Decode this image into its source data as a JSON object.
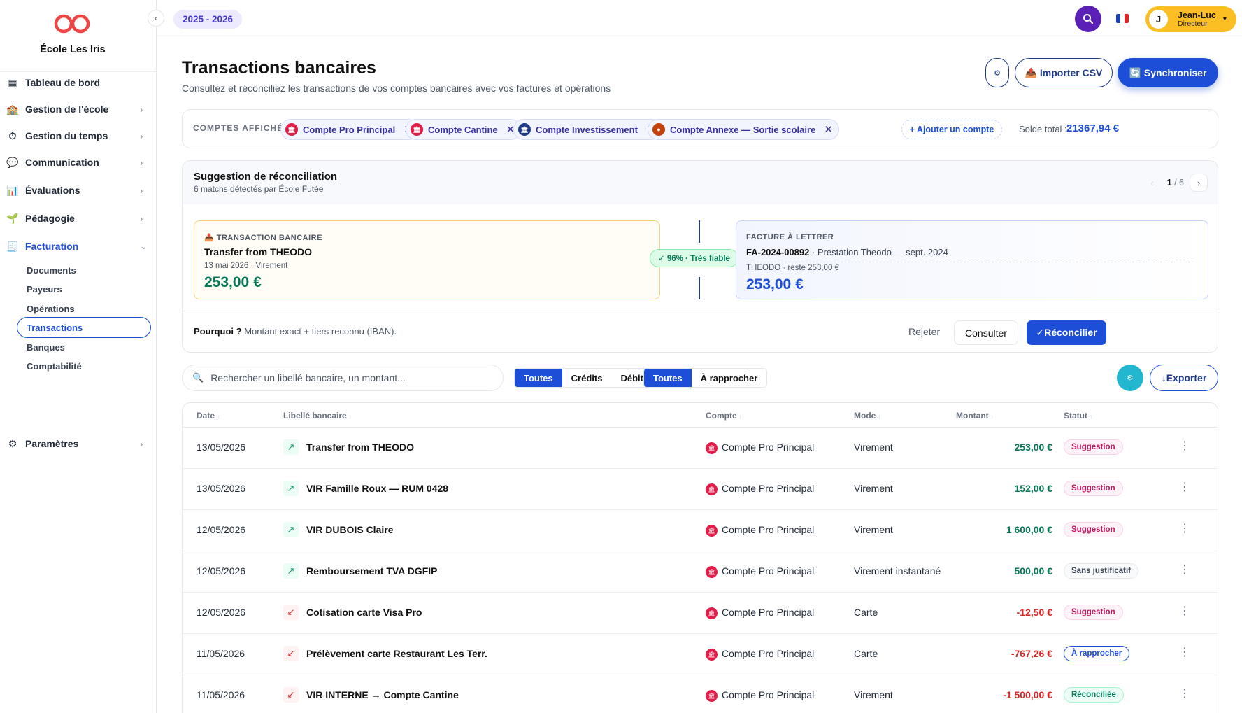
{
  "sidebar": {
    "school_name": "École Les Iris",
    "collapse_icon": "‹",
    "nav": [
      {
        "label": "Tableau de bord",
        "icon": "▦",
        "icon_name": "dashboard-icon",
        "chevron": ""
      },
      {
        "label": "Gestion de l'école",
        "icon": "🏫",
        "icon_name": "school-icon",
        "chevron": "›"
      },
      {
        "label": "Gestion du temps",
        "icon": "⏱",
        "icon_name": "clock-icon",
        "chevron": "›"
      },
      {
        "label": "Communication",
        "icon": "💬",
        "icon_name": "chat-icon",
        "chevron": "›"
      },
      {
        "label": "Évaluations",
        "icon": "📊",
        "icon_name": "chart-icon",
        "chevron": "›"
      },
      {
        "label": "Pédagogie",
        "icon": "🌱",
        "icon_name": "sprout-icon",
        "chevron": "›"
      },
      {
        "label": "Facturation",
        "icon": "🧾",
        "icon_name": "invoice-icon",
        "chevron": "⌄"
      }
    ],
    "sub": [
      "Documents",
      "Payeurs",
      "Opérations",
      "Transactions",
      "Banques",
      "Comptabilité"
    ],
    "settings": {
      "label": "Paramètres",
      "icon": "⚙",
      "chevron": "›"
    }
  },
  "topbar": {
    "year": "2025 - 2026",
    "user_initial": "J",
    "user_name": "Jean-Luc",
    "user_role": "Directeur",
    "chevron": "▾",
    "flag_colors": [
      "#1e40af",
      "#ffffff",
      "#dc2626"
    ]
  },
  "page": {
    "title": "Transactions bancaires",
    "subtitle": "Consultez et réconciliez les transactions de vos comptes bancaires avec vos factures et opérations",
    "gear_icon": "⚙",
    "import_label": "📤 Importer CSV",
    "sync_label": "🔄 Synchroniser"
  },
  "accounts": {
    "title": "COMPTES AFFICHÉS",
    "chips": [
      {
        "label": "Compte Pro Principal",
        "color": "#e11d48",
        "icon": "🏛"
      },
      {
        "label": "Compte Cantine",
        "color": "#e11d48",
        "icon": "🏛"
      },
      {
        "label": "Compte Investissement",
        "color": "#1e3a8a",
        "icon": "🏛"
      },
      {
        "label": "Compte Annexe — Sortie scolaire",
        "color": "#c2410c",
        "icon": "●"
      }
    ],
    "remove_icon": "✕",
    "add_label": "+ Ajouter un compte",
    "total_label": "Solde total :",
    "total_value": "21367,94 €"
  },
  "suggestion": {
    "title": "Suggestion de réconciliation",
    "subtitle": "6 matchs détectés par École Futée",
    "prev": "‹",
    "next": "›",
    "page_current": "1",
    "page_total": "/ 6",
    "transaction": {
      "label": "📤 TRANSACTION BANCAIRE",
      "title": "Transfer from THEODO",
      "meta": "13 mai 2026 · Virement",
      "amount": "253,00 €"
    },
    "match": "✓ 96% · Très fiable",
    "invoice": {
      "label": "FACTURE À LETTRER",
      "ref": "FA-2024-00892",
      "desc": " · Prestation Theodo — sept. 2024",
      "meta": "THEODO · reste 253,00 €",
      "amount": "253,00 €"
    },
    "why_label": "Pourquoi ?",
    "why_text": " Montant exact + tiers reconnu (IBAN).",
    "reject": "Rejeter",
    "consult": "Consulter",
    "reconcile": "✓Réconcilier"
  },
  "filters": {
    "search_placeholder": "Rechercher un libellé bancaire, un montant...",
    "search_icon": "🔍",
    "type_segments": [
      "Toutes",
      "Crédits",
      "Débits"
    ],
    "status_segments": [
      "Toutes",
      "À rapprocher"
    ],
    "filter_icon": "⚙",
    "export_label": "↓Exporter"
  },
  "table": {
    "headers": [
      "Date",
      "Libellé bancaire",
      "Compte",
      "Mode",
      "Montant",
      "Statut"
    ],
    "sort_icon": "↕",
    "rows": [
      {
        "date": "13/05/2026",
        "dir": "↗",
        "libelle": "Transfer from THEODO",
        "compte": "Compte Pro Principal",
        "mode": "Virement",
        "montant": "253,00 €",
        "statut": "Suggestion"
      },
      {
        "date": "13/05/2026",
        "dir": "↗",
        "libelle": "VIR Famille Roux — RUM 0428",
        "compte": "Compte Pro Principal",
        "mode": "Virement",
        "montant": "152,00 €",
        "statut": "Suggestion"
      },
      {
        "date": "12/05/2026",
        "dir": "↗",
        "libelle": "VIR DUBOIS Claire",
        "compte": "Compte Pro Principal",
        "mode": "Virement",
        "montant": "1 600,00 €",
        "statut": "Suggestion"
      },
      {
        "date": "12/05/2026",
        "dir": "↗",
        "libelle": "Remboursement TVA DGFIP",
        "compte": "Compte Pro Principal",
        "mode": "Virement instantané",
        "montant": "500,00 €",
        "statut": "Sans justificatif"
      },
      {
        "date": "12/05/2026",
        "dir": "↙",
        "libelle": "Cotisation carte Visa Pro",
        "compte": "Compte Pro Principal",
        "mode": "Carte",
        "montant": "-12,50 €",
        "statut": "Suggestion"
      },
      {
        "date": "11/05/2026",
        "dir": "↙",
        "libelle": "Prélèvement carte Restaurant Les Terr.",
        "compte": "Compte Pro Principal",
        "mode": "Carte",
        "montant": "-767,26 €",
        "statut": "À rapprocher"
      },
      {
        "date": "11/05/2026",
        "dir": "↙",
        "libelle": "VIR INTERNE → Compte Cantine",
        "compte": "Compte Pro Principal",
        "mode": "Virement",
        "montant": "-1 500,00 €",
        "statut": "Réconciliée"
      }
    ],
    "kebab": "⋮"
  }
}
